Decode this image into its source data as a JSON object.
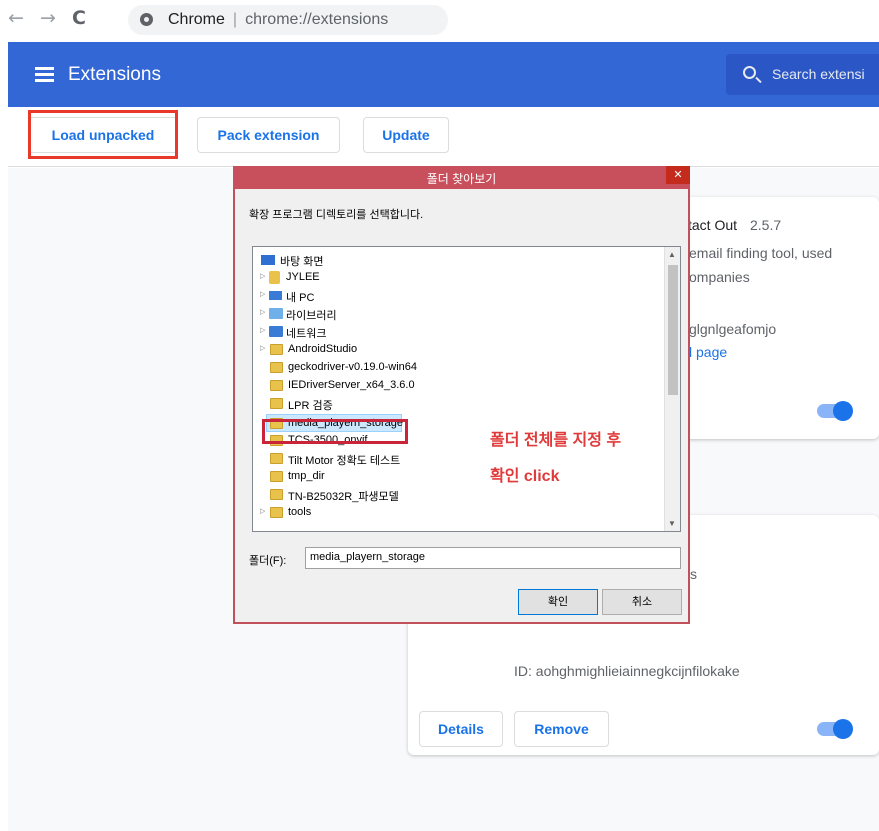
{
  "browser": {
    "site_name": "Chrome",
    "url": "chrome://extensions"
  },
  "header": {
    "title": "Extensions",
    "search_placeholder": "Search extensi"
  },
  "toolbar": {
    "load_unpacked": "Load unpacked",
    "pack_extension": "Pack extension",
    "update": "Update"
  },
  "extensions": [
    {
      "name_fragment": "tact Out",
      "version": "2.5.7",
      "desc_line1": "email finding tool, used",
      "desc_line2": "ompanies",
      "id_fragment": "glgnlgeafomjo",
      "link_fragment": "l page",
      "enabled": true
    },
    {
      "desc_fragment": "s",
      "id_line": "ID: aohghmighlieiainnegkcijnfilokake",
      "details_label": "Details",
      "remove_label": "Remove",
      "enabled": true
    }
  ],
  "dialog": {
    "title": "폴더 찾아보기",
    "description": "확장 프로그램 디렉토리를 선택합니다.",
    "tree_items": [
      {
        "label": "바탕 화면"
      },
      {
        "label": "JYLEE"
      },
      {
        "label": "내 PC"
      },
      {
        "label": "라이브러리"
      },
      {
        "label": "네트워크"
      },
      {
        "label": "AndroidStudio"
      },
      {
        "label": "geckodriver-v0.19.0-win64"
      },
      {
        "label": "IEDriverServer_x64_3.6.0"
      },
      {
        "label": "LPR 검증"
      },
      {
        "label": "media_playern_storage"
      },
      {
        "label": "TCS-3500_onvif"
      },
      {
        "label": "Tilt Motor 정확도 테스트"
      },
      {
        "label": "tmp_dir"
      },
      {
        "label": "TN-B25032R_파생모델"
      },
      {
        "label": "tools"
      }
    ],
    "folder_label": "폴더(F):",
    "folder_value": "media_playern_storage",
    "ok_label": "확인",
    "cancel_label": "취소"
  },
  "annotation": {
    "line1": "폴더 전체를 지정 후",
    "line2": "확인 click"
  },
  "colors": {
    "header_blue": "#3367d6",
    "accent": "#1a73e8",
    "highlight_red": "#e8392b"
  }
}
